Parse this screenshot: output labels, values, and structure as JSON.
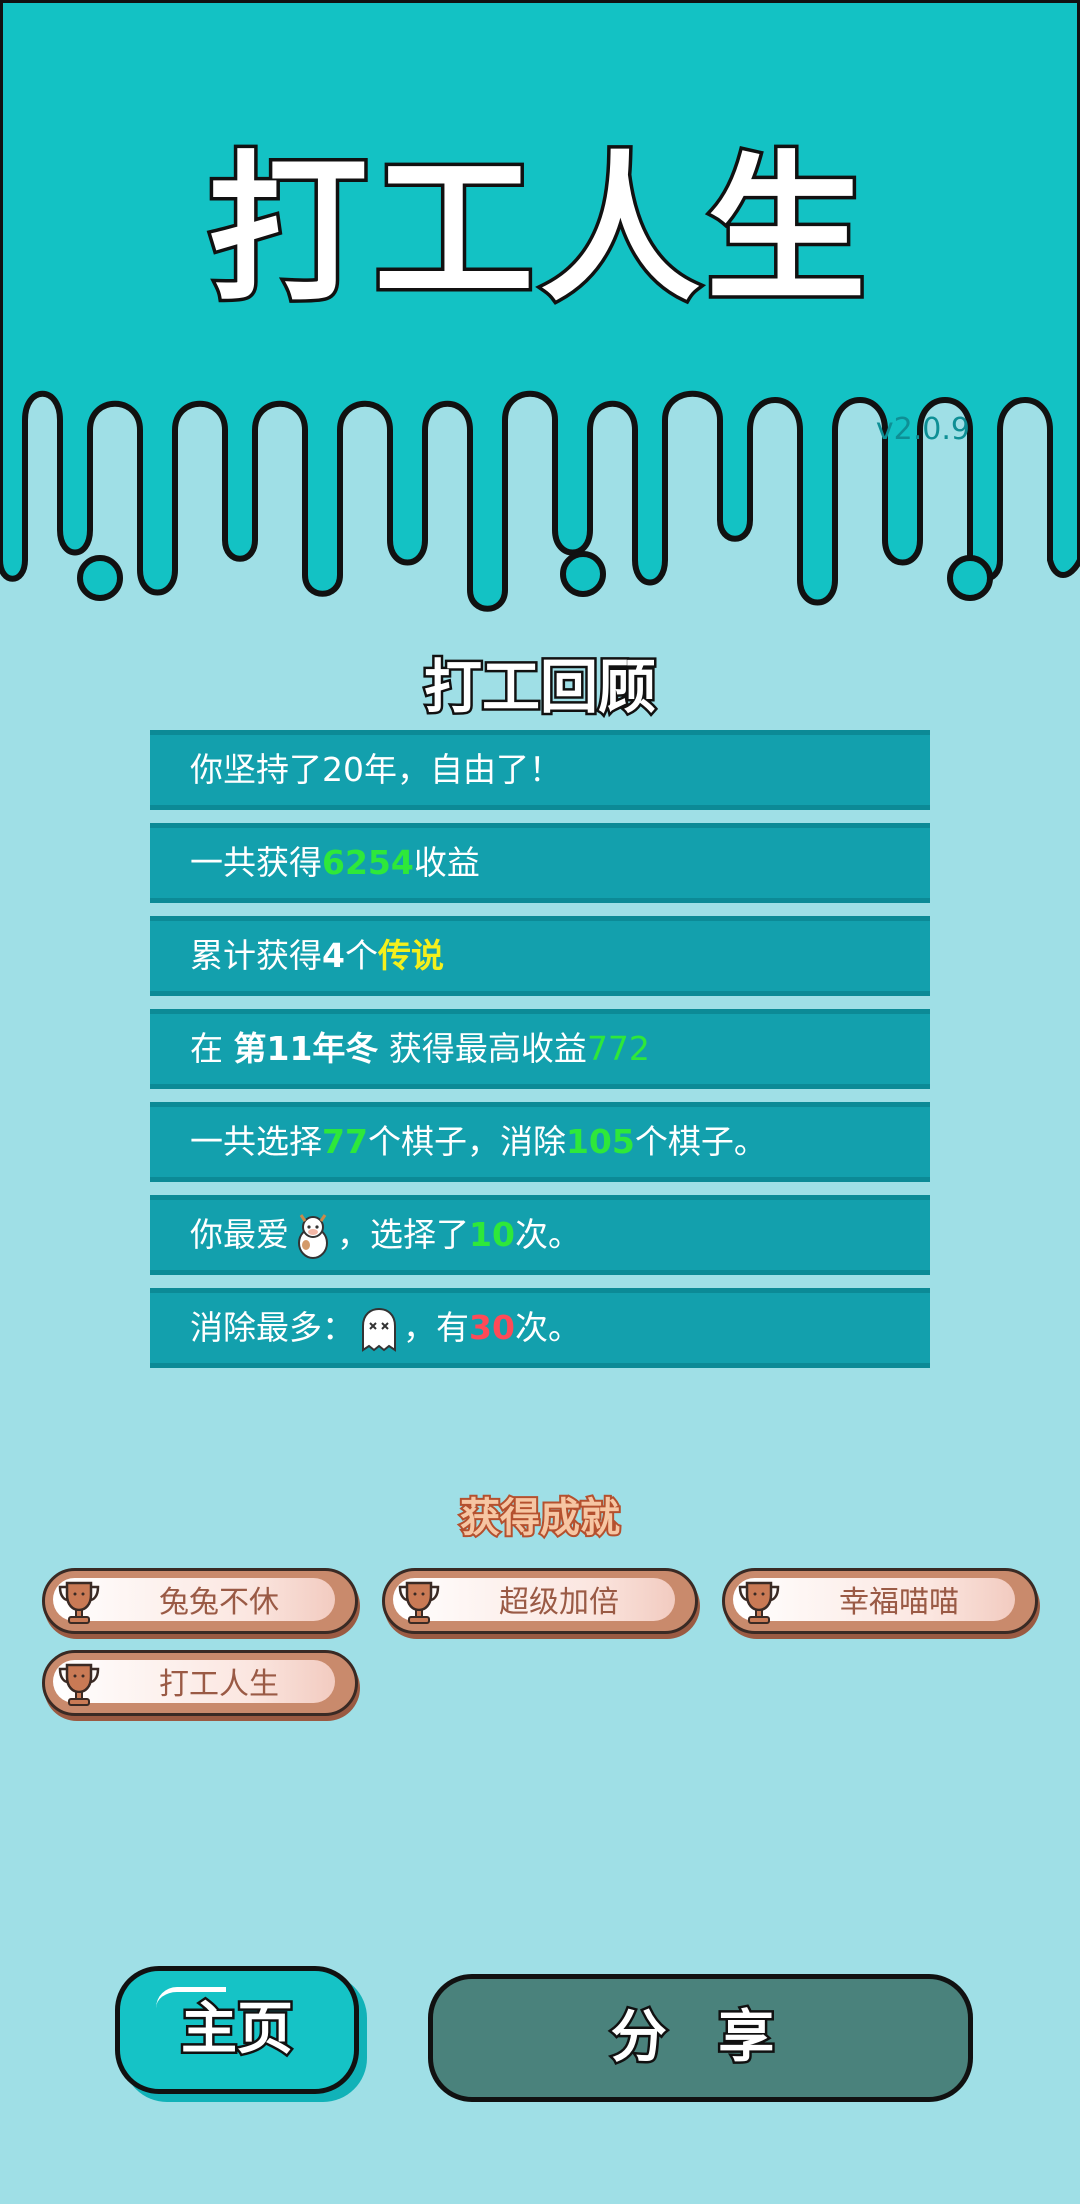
{
  "header": {
    "title": "打工人生",
    "version": "v2.0.9"
  },
  "review": {
    "title": "打工回顾",
    "rows": [
      {
        "parts": [
          "你坚持了20年，自由了！"
        ]
      },
      {
        "pre": "一共获得",
        "value": "6254",
        "post": "收益"
      },
      {
        "pre": "累计获得",
        "count": "4",
        "mid": "个",
        "tag": "传说"
      },
      {
        "pre": "在 ",
        "season": "第11年冬",
        "mid": " 获得最高收益",
        "value": "772"
      },
      {
        "pre": "一共选择",
        "picked": "77",
        "mid": "个棋子，消除",
        "removed": "105",
        "post": "个棋子。"
      },
      {
        "pre": "你最爱",
        "icon": "cow-piece-icon",
        "mid": "，选择了",
        "value": "10",
        "post": "次。"
      },
      {
        "pre": "消除最多：",
        "icon": "ghost-piece-icon",
        "mid": "，有",
        "value": "30",
        "post": "次。"
      }
    ]
  },
  "achievements": {
    "title": "获得成就",
    "icon": "trophy-icon",
    "items": [
      "兔兔不休",
      "超级加倍",
      "幸福喵喵",
      "打工人生"
    ]
  },
  "buttons": {
    "home": "主页",
    "share": "分 享"
  },
  "colors": {
    "top_bg": "#13c2c4",
    "bottom_bg": "#9fdfe6",
    "row_bg": "#13a0ad",
    "green": "#2ee83a",
    "yellow": "#f4f01c",
    "red": "#ff4a57"
  }
}
